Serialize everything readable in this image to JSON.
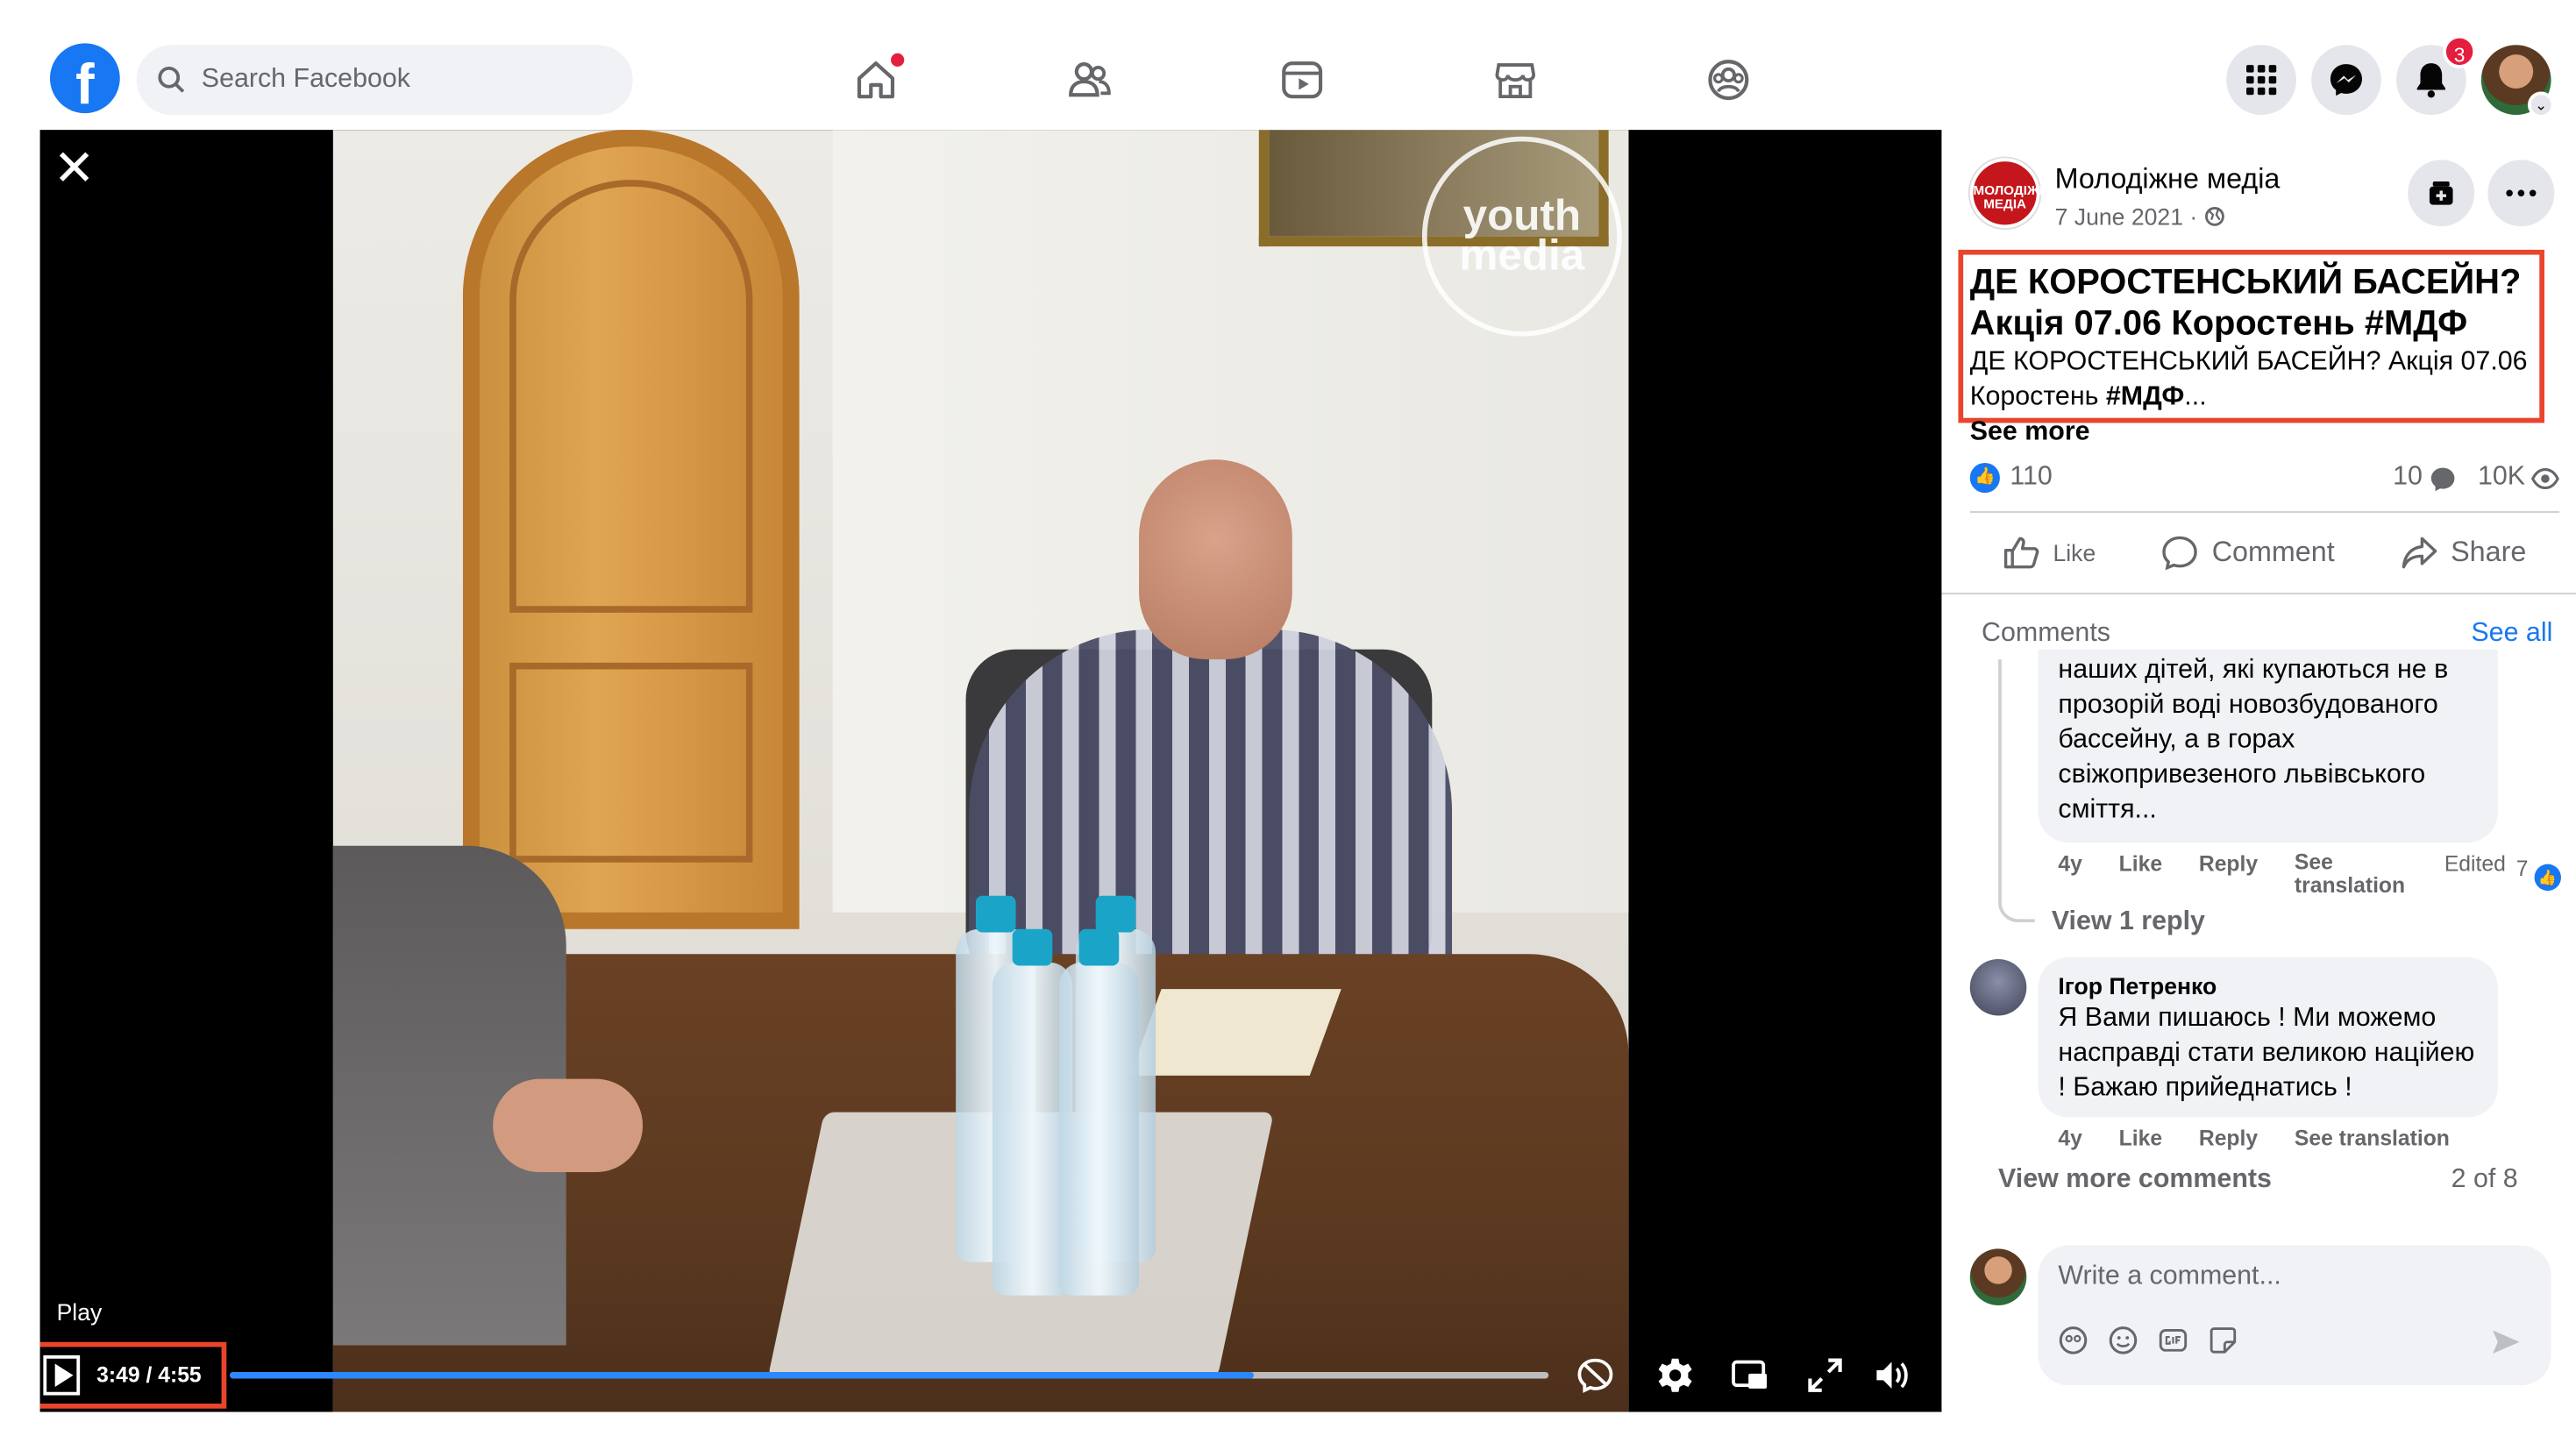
{
  "topbar": {
    "logo": "f",
    "search_placeholder": "Search Facebook",
    "notification_count": "3",
    "nav_icons": [
      "home-icon",
      "friends-icon",
      "video-icon",
      "marketplace-icon",
      "groups-icon"
    ],
    "right_icons": [
      "menu-grid-icon",
      "messenger-icon",
      "notifications-icon"
    ]
  },
  "video": {
    "watermark": "youth media",
    "tooltip": "Play",
    "current_time": "3:49",
    "separator": "/",
    "duration": "4:55",
    "progress_fraction": 0.776,
    "close_glyph": "✕",
    "accent_color": "#2d88ff",
    "highlight_color": "#e8452c"
  },
  "post": {
    "avatar_text": "МОЛОДІЖНЕ МЕДІА",
    "author": "Молодіжне медіа",
    "date": "7 June 2021 ·",
    "title": "ДЕ КОРОСТЕНСЬКИЙ БАСЕЙН? Акція 07.06 Коростень #МДФ",
    "body": "ДЕ КОРОСТЕНСЬКИЙ БАСЕЙН? Акція 07.06 Коростень",
    "body_tag": "#МДФ",
    "body_ellipsis": "...",
    "see_more": "See more",
    "likes": "110",
    "comments_count": "10",
    "views": "10K",
    "actions": {
      "like": "Like",
      "comment": "Comment",
      "share": "Share"
    }
  },
  "comments": {
    "header": "Comments",
    "see_all": "See all",
    "first": {
      "text": "наших дітей, які купаються не в прозорій воді новозбудованого бассейну, а в горах свіжопривезеного львівського сміття...",
      "meta": {
        "age": "4y",
        "like": "Like",
        "reply": "Reply",
        "translate": "See translation",
        "edited": "Edited",
        "reactions": "7"
      },
      "view_reply": "View 1 reply"
    },
    "second": {
      "name": "Ігор Петренко",
      "text": "Я Вами пишаюсь ! Ми можемо насправді стати великою наційею ! Бажаю прийеднатись !",
      "meta": {
        "age": "4y",
        "like": "Like",
        "reply": "Reply",
        "translate": "See translation"
      }
    },
    "view_more": "View more comments",
    "page_count": "2 of 8",
    "write_placeholder": "Write a comment..."
  }
}
